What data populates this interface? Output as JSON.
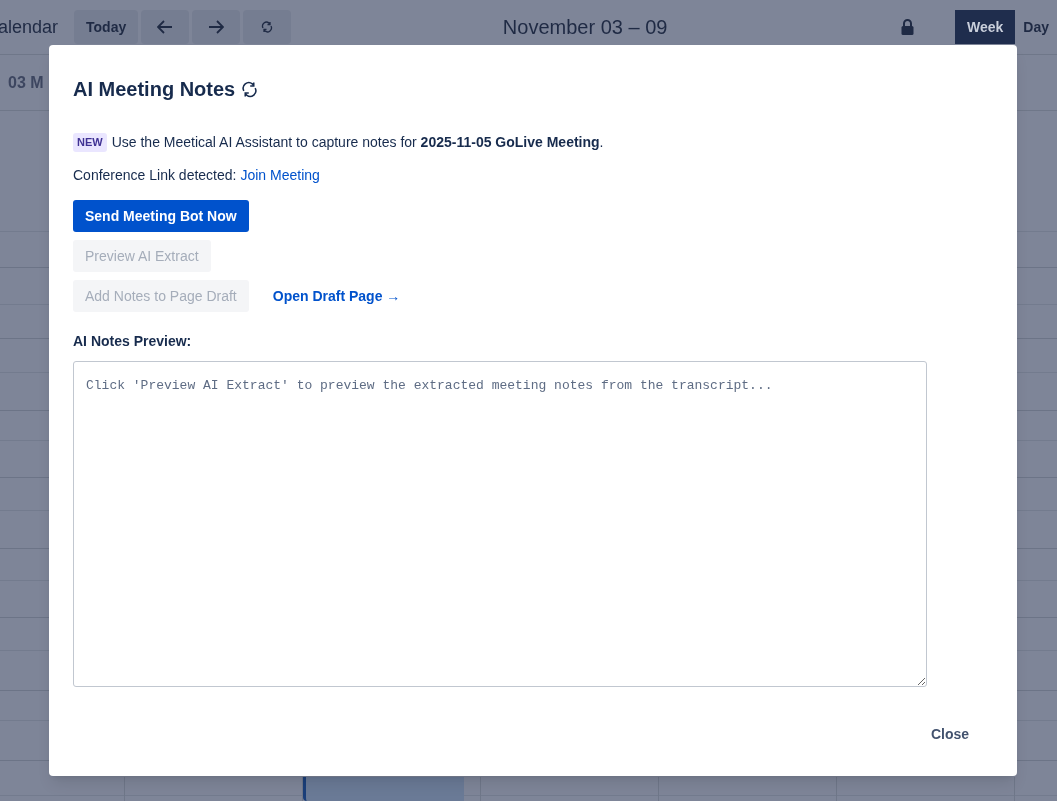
{
  "app": {
    "title": "alendar"
  },
  "toolbar": {
    "today": "Today"
  },
  "range_title": "November 03 – 09",
  "views": [
    {
      "label": "Week",
      "selected": true
    },
    {
      "label": "Day",
      "selected": false
    }
  ],
  "day_headers": [
    "03 M"
  ],
  "dialog": {
    "title": "AI Meeting Notes",
    "badge": "NEW",
    "intro": "Use the Meetical AI Assistant to capture notes for **2025-11-05 GoLive Meeting**.",
    "conference_label": "Conference Link detected:",
    "conference_link": "Join Meeting",
    "action_rows": [
      [
        {
          "label": "Send Meeting Bot Now",
          "kind": "primary",
          "disabled": false
        }
      ],
      [
        {
          "label": "Preview AI Extract",
          "kind": "secondary",
          "disabled": true
        }
      ],
      [
        {
          "label": "Add Notes to Page Draft",
          "kind": "secondary",
          "disabled": true
        },
        {
          "label": "Open Draft Page →",
          "kind": "link",
          "disabled": false
        }
      ]
    ],
    "preview_label": "AI Notes Preview:",
    "preview": {
      "placeholder": "Click 'Preview AI Extract' to preview the extracted meeting notes from the transcript..."
    },
    "close": "Close"
  }
}
